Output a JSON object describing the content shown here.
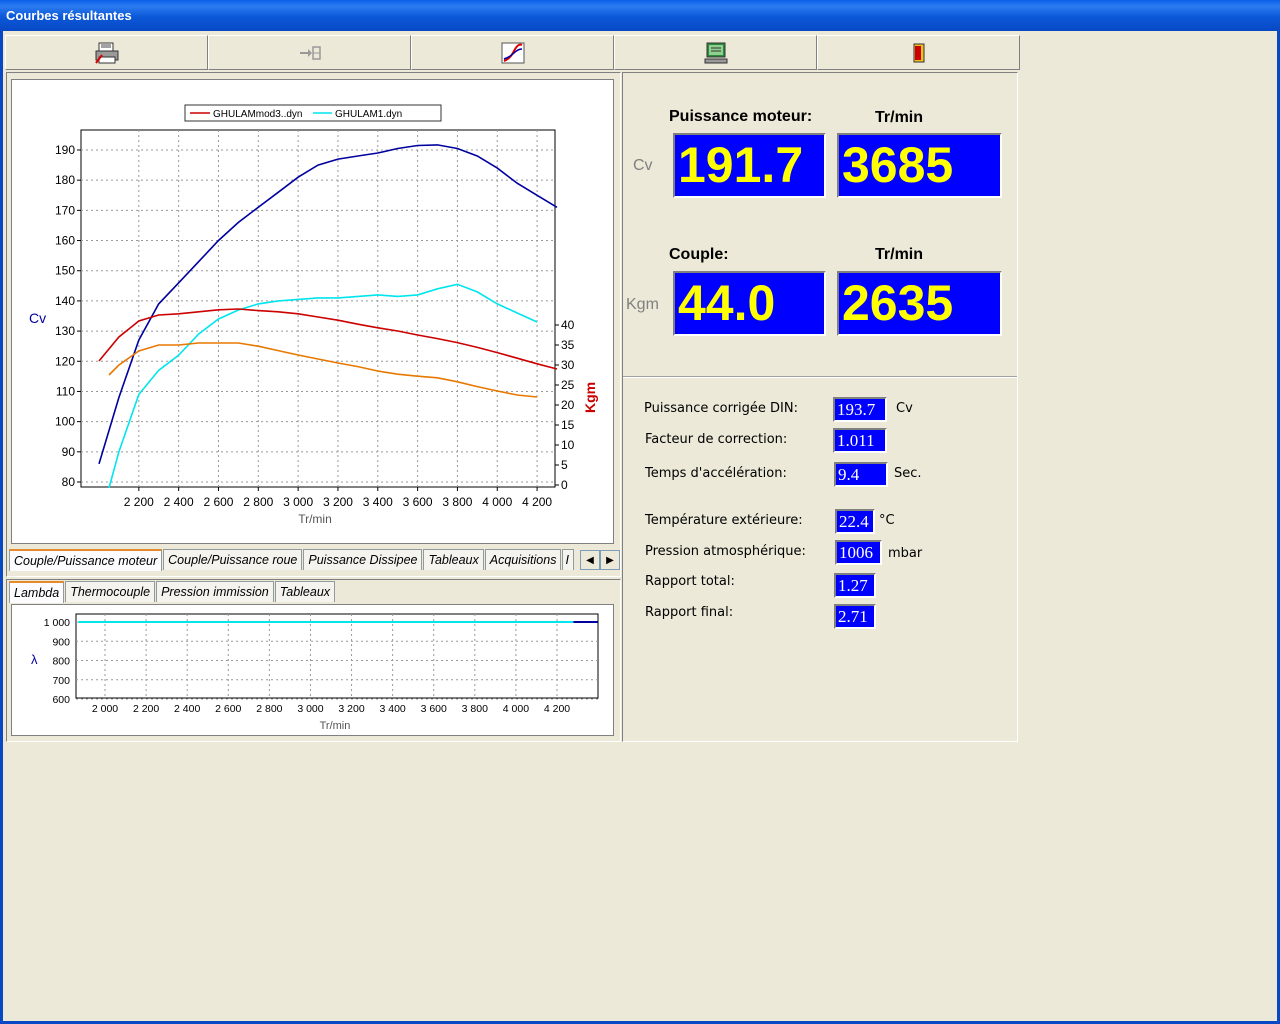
{
  "window": {
    "title": "Courbes résultantes"
  },
  "toolbar": {
    "buttons": [
      "print-icon",
      "transfer-icon",
      "curve-icon",
      "monitor-icon",
      "exit-icon"
    ]
  },
  "main_chart": {
    "legend": [
      "GHULAMmod3..dyn",
      "GHULAM1.dyn"
    ],
    "ylabel_left": "Cv",
    "ylabel_right": "Kgm",
    "xlabel": "Tr/min",
    "x_ticks": [
      "2 200",
      "2 400",
      "2 600",
      "2 800",
      "3 000",
      "3 200",
      "3 400",
      "3 600",
      "3 800",
      "4 000",
      "4 200"
    ],
    "y_left_ticks": [
      "190",
      "180",
      "170",
      "160",
      "150",
      "140",
      "130",
      "120",
      "110",
      "100",
      "90",
      "80"
    ],
    "y_right_ticks": [
      "40",
      "35",
      "30",
      "25",
      "20",
      "15",
      "10",
      "5",
      "0"
    ]
  },
  "tabs_top": {
    "items": [
      "Couple/Puissance moteur",
      "Couple/Puissance roue",
      "Puissance Dissipee",
      "Tableaux",
      "Acquisitions",
      "I"
    ],
    "active": 0
  },
  "tabs_bottom": {
    "items": [
      "Lambda",
      "Thermocouple",
      "Pression immission",
      "Tableaux"
    ],
    "active": 0
  },
  "lambda_chart": {
    "ylabel": "λ",
    "xlabel": "Tr/min",
    "x_ticks": [
      "2 000",
      "2 200",
      "2 400",
      "2 600",
      "2 800",
      "3 000",
      "3 200",
      "3 400",
      "3 600",
      "3 800",
      "4 000",
      "4 200"
    ],
    "y_ticks": [
      "1 000",
      "900",
      "800",
      "700",
      "600"
    ]
  },
  "readout": {
    "power_header": "Puissance moteur:",
    "rpm_header": "Tr/min",
    "power_unit": "Cv",
    "power_value": "191.7",
    "power_rpm": "3685",
    "torque_header": "Couple:",
    "torque_rpm_header": "Tr/min",
    "torque_unit": "Kgm",
    "torque_value": "44.0",
    "torque_rpm": "2635"
  },
  "details": {
    "din_label": "Puissance corrigée DIN:",
    "din_value": "193.7",
    "din_unit": "Cv",
    "factor_label": "Facteur de correction:",
    "factor_value": "1.011",
    "accel_label": "Temps d'accélération:",
    "accel_value": "9.4",
    "accel_unit": "Sec.",
    "temp_label": "Température extérieure:",
    "temp_value": "22.4",
    "temp_unit": "°C",
    "pressure_label": "Pression atmosphérique:",
    "pressure_value": "1006",
    "pressure_unit": "mbar",
    "ratio_total_label": "Rapport total:",
    "ratio_total_value": "1.27",
    "ratio_final_label": "Rapport final:",
    "ratio_final_value": "2.71"
  },
  "chart_data": [
    {
      "type": "line",
      "xlabel": "Tr/min",
      "ylabel": "Cv",
      "y2label": "Kgm",
      "xlim": [
        1980,
        4380
      ],
      "ylim": [
        78,
        195
      ],
      "y2lim": [
        0,
        45
      ],
      "grid": true,
      "legend": "top",
      "series": [
        {
          "name": "GHULAMmod3..dyn",
          "axis": "Cv",
          "color": "#0000A0",
          "x": [
            2000,
            2100,
            2200,
            2300,
            2400,
            2500,
            2600,
            2700,
            2800,
            2900,
            3000,
            3100,
            3200,
            3300,
            3400,
            3500,
            3600,
            3700,
            3800,
            3900,
            4000,
            4100,
            4200,
            4300
          ],
          "y": [
            86,
            108,
            127,
            139,
            146,
            153,
            160,
            166,
            171,
            176,
            181,
            185,
            187,
            188,
            189,
            190.5,
            191.5,
            191.7,
            190.5,
            188,
            184,
            179,
            175,
            171
          ]
        },
        {
          "name": "GHULAM1.dyn",
          "axis": "Cv",
          "color": "#00E5EE",
          "x": [
            2050,
            2100,
            2200,
            2300,
            2400,
            2500,
            2600,
            2700,
            2800,
            2900,
            3000,
            3100,
            3200,
            3300,
            3400,
            3500,
            3600,
            3700,
            3800,
            3900,
            4000,
            4100,
            4200
          ],
          "y": [
            78,
            90,
            109,
            117,
            122,
            129,
            134,
            137,
            139,
            140,
            140.5,
            141,
            141,
            141.5,
            142,
            141.5,
            142,
            144,
            145.5,
            143,
            139,
            136,
            133
          ]
        },
        {
          "name": "GHULAMmod3..dyn",
          "axis": "Kgm",
          "color": "#CC0000",
          "x": [
            2000,
            2100,
            2200,
            2300,
            2400,
            2500,
            2600,
            2700,
            2800,
            2900,
            3000,
            3100,
            3200,
            3300,
            3400,
            3500,
            3600,
            3700,
            3800,
            3900,
            4000,
            4100,
            4200,
            4300
          ],
          "y": [
            31,
            37,
            41,
            42.5,
            42.8,
            43.3,
            43.8,
            44.0,
            43.6,
            43.3,
            42.8,
            42,
            41.2,
            40.2,
            39.3,
            38.5,
            37.5,
            36.6,
            35.6,
            34.4,
            33.1,
            31.7,
            30.3,
            29
          ]
        },
        {
          "name": "GHULAM1.dyn",
          "axis": "Kgm",
          "color": "#E87800",
          "x": [
            2050,
            2100,
            2200,
            2300,
            2400,
            2500,
            2600,
            2700,
            2800,
            2900,
            3000,
            3100,
            3200,
            3300,
            3400,
            3500,
            3600,
            3700,
            3800,
            3900,
            4000,
            4100,
            4200
          ],
          "y": [
            27.5,
            30,
            33.5,
            35,
            35,
            35.5,
            35.5,
            35.5,
            34.7,
            33.6,
            32.5,
            31.5,
            30.5,
            29.6,
            28.5,
            27.7,
            27.2,
            26.8,
            25.8,
            24.6,
            23.5,
            22.5,
            22
          ]
        }
      ]
    },
    {
      "type": "line",
      "xlabel": "Tr/min",
      "ylabel": "λ",
      "xlim": [
        1870,
        4400
      ],
      "ylim": [
        600,
        1040
      ],
      "grid": true,
      "series": [
        {
          "name": "GHULAM1.dyn",
          "color": "#00E5EE",
          "x": [
            1870,
            4280
          ],
          "y": [
            1000,
            1000
          ]
        },
        {
          "name": "GHULAMmod3..dyn",
          "color": "#0000A0",
          "x": [
            4280,
            4400
          ],
          "y": [
            1000,
            1000
          ]
        }
      ]
    }
  ]
}
